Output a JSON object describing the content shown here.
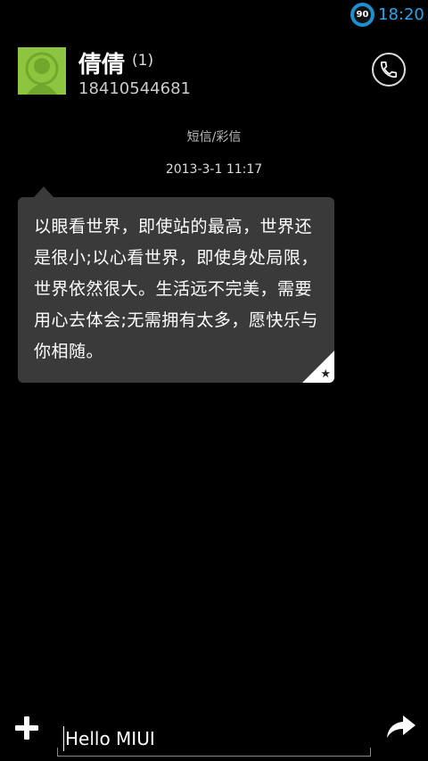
{
  "status_bar": {
    "battery_level": "90",
    "time": "18:20",
    "accent_color": "#2da6e6"
  },
  "header": {
    "contact_name": "倩倩",
    "message_count": "(1)",
    "phone_number": "18410544681",
    "avatar_color": "#8cc63f",
    "call_icon": "phone-icon"
  },
  "thread": {
    "type_label": "短信/彩信",
    "messages": [
      {
        "timestamp": "2013-3-1 11:17",
        "text": "以眼看世界，即使站的最高，世界还是很小;以心看世界，即使身处局限，世界依然很大。生活远不完美，需要用心去体会;无需拥有太多，愿快乐与你相随。",
        "starred": true
      }
    ]
  },
  "composer": {
    "input_value": "Hello MIUI",
    "add_icon": "plus-icon",
    "send_icon": "send-arrow-icon"
  }
}
